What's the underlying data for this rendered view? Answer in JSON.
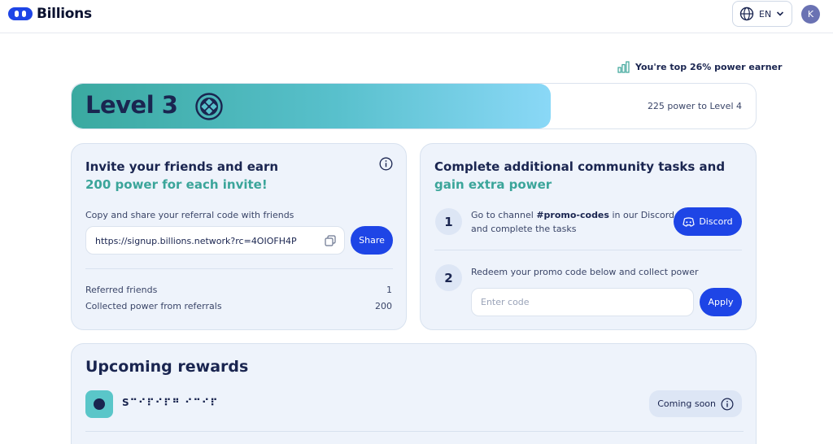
{
  "header": {
    "brand": "Billions",
    "language": "EN",
    "avatar_initial": "K"
  },
  "stats_banner": {
    "top_earner": "You're top 26% power earner"
  },
  "level": {
    "title": "Level 3",
    "next_level_text": "225 power to Level 4",
    "progress_fraction": 0.7
  },
  "invite": {
    "title": "Invite your friends and earn",
    "subtitle": "200 power for each invite!",
    "instruction": "Copy and share your referral code with friends",
    "referral_url": "https://signup.billions.network?rc=4OIOFH4P",
    "share_label": "Share",
    "referred_label": "Referred friends",
    "referred_value": "1",
    "collected_label": "Collected power from referrals",
    "collected_value": "200"
  },
  "tasks": {
    "title": "Complete additional community tasks and",
    "subtitle": "gain extra power",
    "step1_num": "1",
    "step1_prefix": "Go to channel ",
    "step1_channel": "#promo-codes",
    "step1_mid": " in our Discord",
    "step1_line2": "and complete the tasks",
    "discord_label": "Discord",
    "step2_num": "2",
    "step2_text": "Redeem your promo code below and collect power",
    "promo_placeholder": "Enter code",
    "apply_label": "Apply"
  },
  "rewards": {
    "title": "Upcoming rewards",
    "item_name": "S⠉⠊⠏⠊⠏⠛ ⠊⠉⠊⠏",
    "coming_soon": "Coming soon"
  },
  "colors": {
    "accent_blue": "#1e45e6",
    "accent_teal": "#3ba59a",
    "navy": "#1a2550",
    "card_bg": "#eef3fb"
  }
}
